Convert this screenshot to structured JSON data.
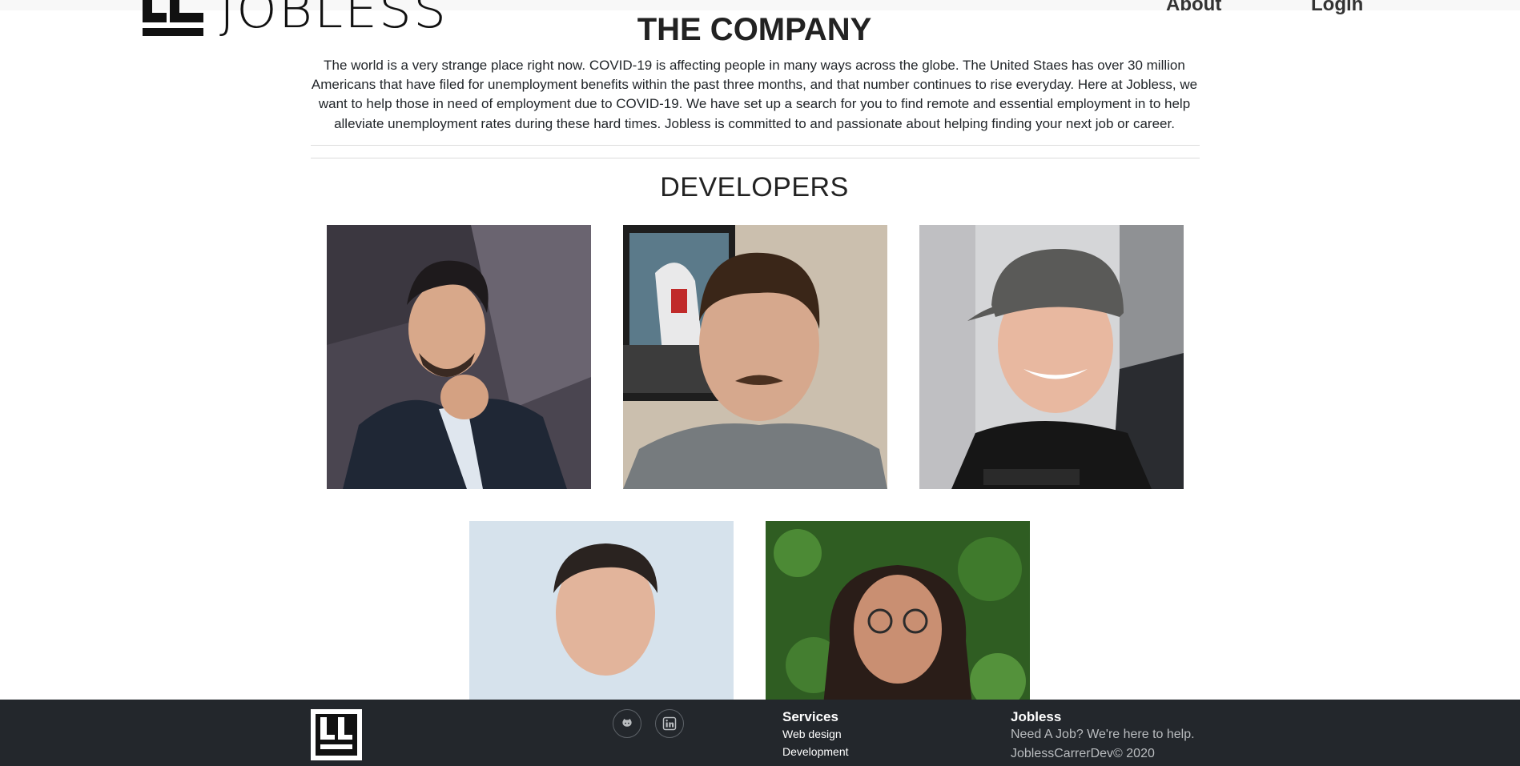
{
  "header": {
    "logo_text": "JOBLESS",
    "nav": {
      "about": "About",
      "login": "Login"
    }
  },
  "company": {
    "title": "THE COMPANY",
    "text": "The world is a very strange place right now. COVID-19 is affecting people in many ways across the globe. The United Staes has over 30 million Americans that have filed for unemployment benefits within the past three months, and that number continues to rise everyday. Here at Jobless, we want to help those in need of employment due to COVID-19. We have set up a search for you to find remote and essential employment in to help alleviate unemployment rates during these hard times. Jobless is committed to and passionate about helping finding your next job or career."
  },
  "developers": {
    "title": "DEVELOPERS",
    "photos": [
      {
        "icon": "developer-photo-1"
      },
      {
        "icon": "developer-photo-2"
      },
      {
        "icon": "developer-photo-3"
      },
      {
        "icon": "developer-photo-4"
      },
      {
        "icon": "developer-photo-5"
      }
    ]
  },
  "footer": {
    "social_icons": [
      "github-icon",
      "linkedin-icon"
    ],
    "services": {
      "heading": "Services",
      "links": [
        "Web design",
        "Development"
      ]
    },
    "brand": {
      "heading": "Jobless",
      "tagline": "Need A Job? We're here to help.",
      "copyright": "JoblessCarrerDev© 2020"
    }
  },
  "colors": {
    "footer_bg": "#23272c",
    "text": "#212529",
    "footer_muted": "#b9bcbf"
  }
}
